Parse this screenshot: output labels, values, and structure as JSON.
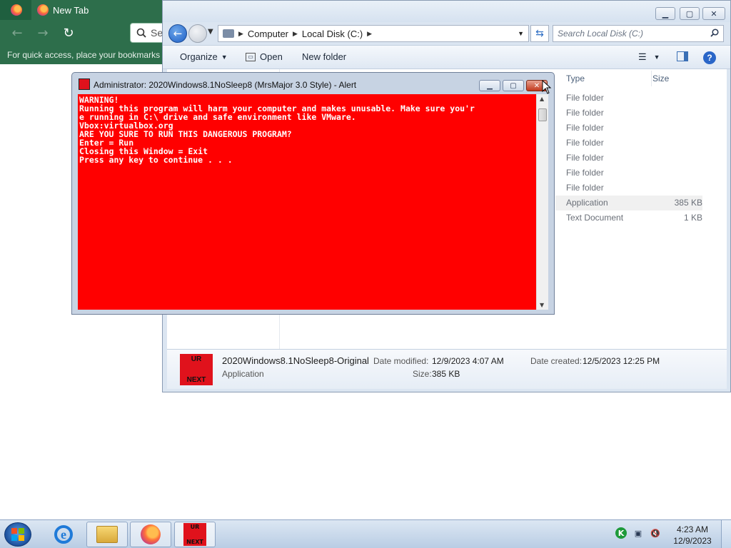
{
  "firefox": {
    "tab_title": "New Tab",
    "search_placeholder": "Se",
    "bookmarks_text": "For quick access, place your bookmarks h"
  },
  "explorer": {
    "address": {
      "crumbs": [
        "Computer",
        "Local Disk (C:)"
      ]
    },
    "search_placeholder": "Search Local Disk (C:)",
    "toolbar": {
      "organize": "Organize",
      "open": "Open",
      "new_folder": "New folder"
    },
    "columns": {
      "type": "Type",
      "size": "Size"
    },
    "rows": [
      {
        "type": "File folder",
        "size": ""
      },
      {
        "type": "File folder",
        "size": ""
      },
      {
        "type": "File folder",
        "size": ""
      },
      {
        "type": "File folder",
        "size": ""
      },
      {
        "type": "File folder",
        "size": ""
      },
      {
        "type": "File folder",
        "size": ""
      },
      {
        "type": "File folder",
        "size": ""
      },
      {
        "type": "Application",
        "size": "385 KB"
      },
      {
        "type": "Text Document",
        "size": "1 KB"
      }
    ],
    "details": {
      "thumb_top": "UR",
      "thumb_bottom": "NEXT",
      "name": "2020Windows8.1NoSleep8-Original",
      "kind": "Application",
      "modified_label": "Date modified:",
      "modified_value": "12/9/2023 4:07 AM",
      "size_label": "Size:",
      "size_value": "385 KB",
      "created_label": "Date created:",
      "created_value": "12/5/2023 12:25 PM"
    }
  },
  "alert": {
    "title": "Administrator:  2020Windows8.1NoSleep8 (MrsMajor 3.0 Style) - Alert",
    "console_lines": [
      "WARNING!",
      "Running this program will harm your computer and makes unusable. Make sure you'r",
      "e running in C:\\ drive and safe environment like VMware.",
      "Vbox:virtualbox.org",
      "ARE YOU SURE TO RUN THIS DANGEROUS PROGRAM?",
      "Enter = Run",
      "Closing this Window = Exit",
      "Press any key to continue . . ."
    ],
    "console_bg": "#ff0000",
    "console_fg": "#ffffff"
  },
  "taskbar": {
    "ur_top": "UR",
    "ur_bottom": "NEXT",
    "clock_time": "4:23 AM",
    "clock_date": "12/9/2023"
  }
}
